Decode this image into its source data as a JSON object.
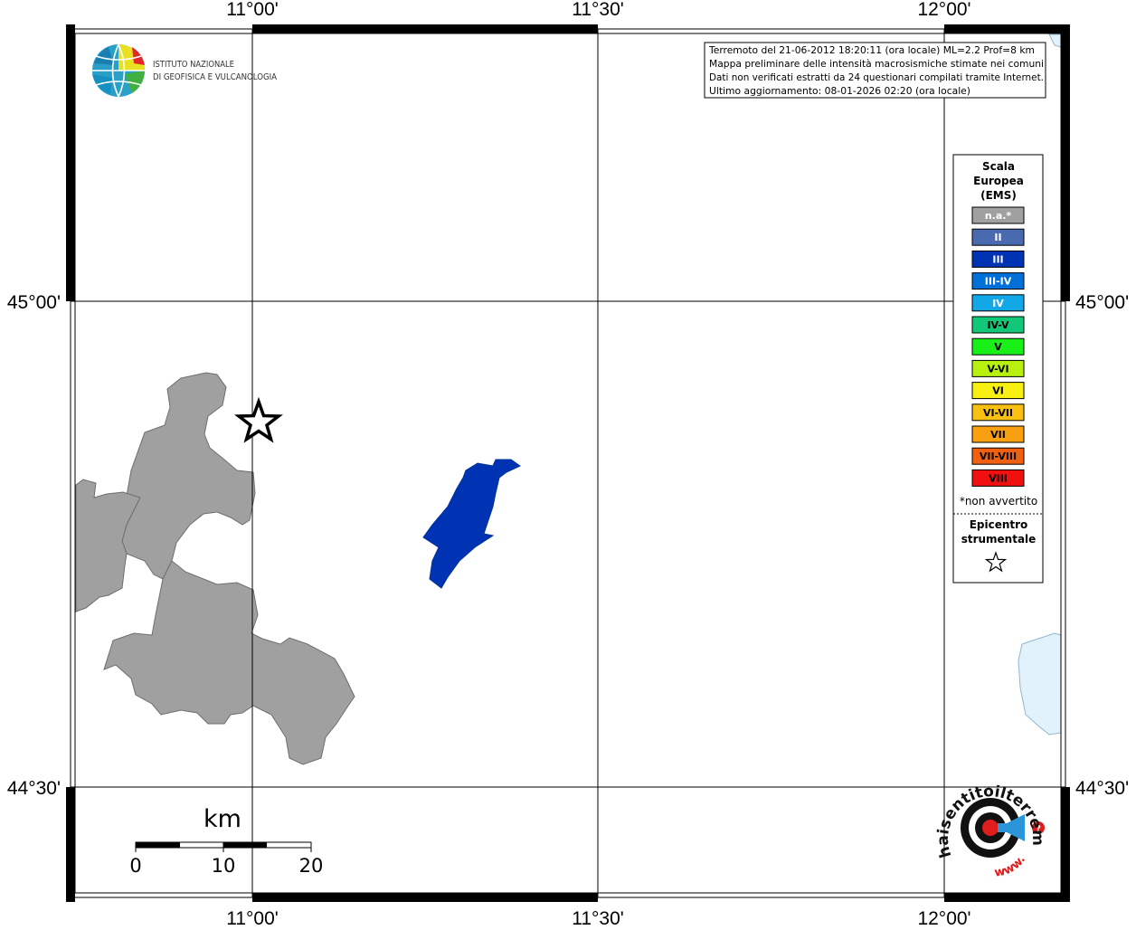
{
  "axes": {
    "top_labels": [
      "11°00'",
      "11°30'",
      "12°00'"
    ],
    "bottom_labels": [
      "11°00'",
      "11°30'",
      "12°00'"
    ],
    "left_labels": [
      "45°00'",
      "44°30'"
    ],
    "right_labels": [
      "45°00'",
      "44°30'"
    ]
  },
  "logo": {
    "line1": "ISTITUTO NAZIONALE",
    "line2": "DI GEOFISICA E VULCANOLOGIA"
  },
  "info_box": {
    "line1": "Terremoto del 21-06-2012 18:20:11 (ora locale) ML=2.2 Prof=8 km",
    "line2": "Mappa preliminare delle intensità macrosismiche stimate nei comuni",
    "line3": "Dati non verificati estratti da 24 questionari compilati tramite Internet.",
    "line4": "Ultimo aggiornamento: 08-01-2026 02:20 (ora locale)"
  },
  "legend": {
    "title1": "Scala",
    "title2": "Europea",
    "title3": "(EMS)",
    "items": [
      {
        "label": "n.a.*",
        "color": "#a0a0a0",
        "text_color": "#ffffff"
      },
      {
        "label": "II",
        "color": "#4a6ab0",
        "text_color": "#ffffff"
      },
      {
        "label": "III",
        "color": "#0033b3",
        "text_color": "#ffffff"
      },
      {
        "label": "III-IV",
        "color": "#0070d8",
        "text_color": "#ffffff"
      },
      {
        "label": "IV",
        "color": "#12a8e8",
        "text_color": "#ffffff"
      },
      {
        "label": "IV-V",
        "color": "#12c878",
        "text_color": "#000000"
      },
      {
        "label": "V",
        "color": "#18f018",
        "text_color": "#000000"
      },
      {
        "label": "V-VI",
        "color": "#b8f010",
        "text_color": "#000000"
      },
      {
        "label": "VI",
        "color": "#f8f010",
        "text_color": "#000000"
      },
      {
        "label": "VI-VII",
        "color": "#f8c010",
        "text_color": "#000000"
      },
      {
        "label": "VII",
        "color": "#f8a010",
        "text_color": "#000000"
      },
      {
        "label": "VII-VIII",
        "color": "#f06010",
        "text_color": "#000000"
      },
      {
        "label": "VIII",
        "color": "#f01010",
        "text_color": "#000000"
      }
    ],
    "note": "*non avvertito",
    "epicenter1": "Epicentro",
    "epicenter2": "strumentale"
  },
  "scale_bar": {
    "unit": "km",
    "ticks": [
      "0",
      "10",
      "20"
    ]
  },
  "hst_logo": {
    "url_text": "haisentitoilterremoto.it",
    "prefix": "www."
  },
  "colors": {
    "not_available": "#a0a0a0",
    "intensity_III": "#0033b3",
    "sea": "#e2f2fb"
  }
}
